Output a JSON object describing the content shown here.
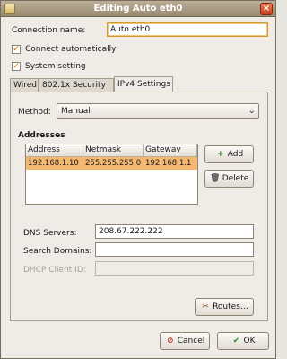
{
  "window": {
    "title": "Editing Auto eth0",
    "close_glyph": "×"
  },
  "connection": {
    "name_label": "Connection name:",
    "name_value": "Auto eth0"
  },
  "checkboxes": [
    {
      "label": "Connect automatically",
      "checked": true
    },
    {
      "label": "System setting",
      "checked": true
    }
  ],
  "tabs": [
    {
      "label": "Wired"
    },
    {
      "label": "802.1x Security"
    },
    {
      "label": "IPv4 Settings",
      "active": true
    }
  ],
  "ipv4": {
    "method_label": "Method:",
    "method_value": "Manual",
    "addresses_title": "Addresses",
    "columns": [
      "Address",
      "Netmask",
      "Gateway"
    ],
    "rows": [
      [
        "192.168.1.10",
        "255.255.255.0",
        "192.168.1.1"
      ]
    ],
    "add_label": "Add",
    "delete_label": "Delete",
    "dns_label": "DNS Servers:",
    "dns_value": "208.67.222.222",
    "search_domains_label": "Search Domains:",
    "search_domains_value": "",
    "dhcp_client_id_label": "DHCP Client ID:",
    "dhcp_client_id_value": "",
    "routes_label": "Routes…"
  },
  "footer": {
    "cancel_label": "Cancel",
    "ok_label": "OK"
  }
}
